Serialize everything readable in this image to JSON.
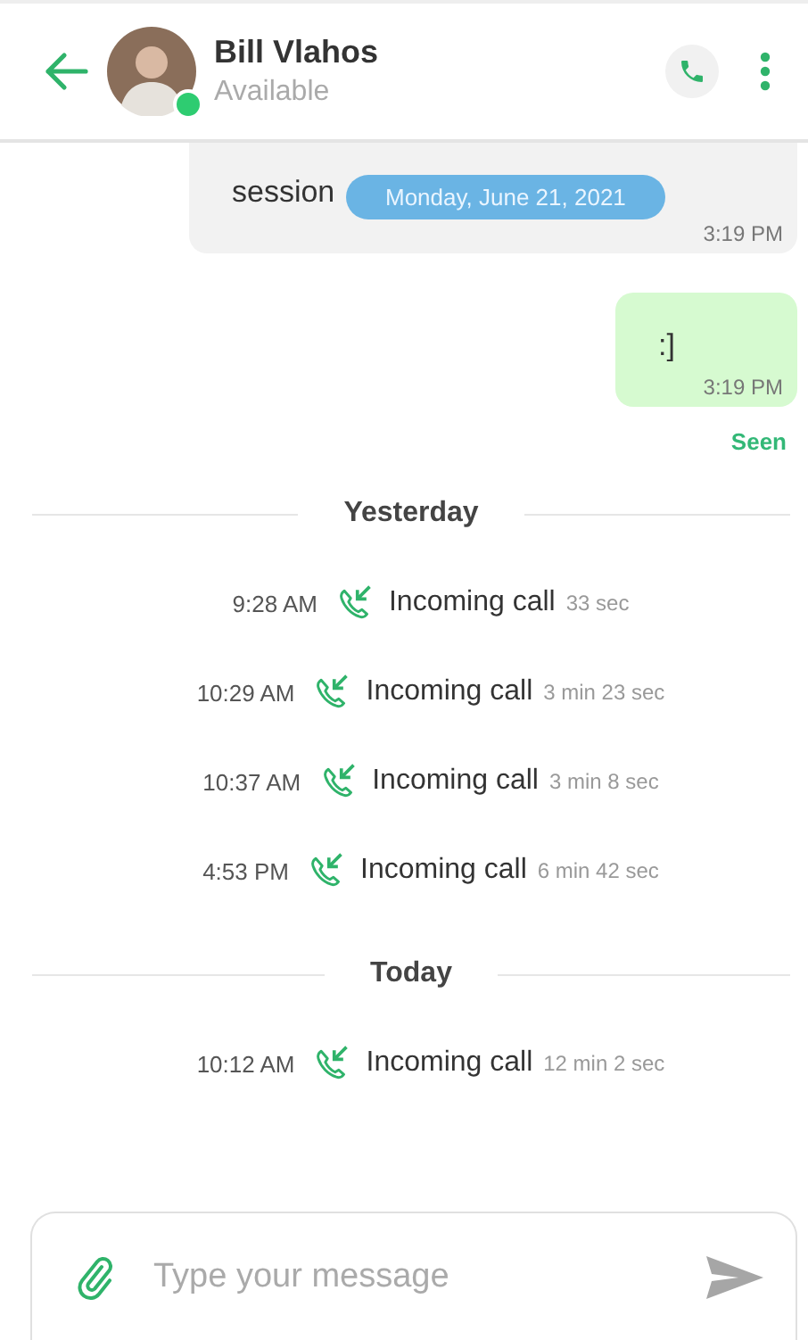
{
  "header": {
    "name": "Bill Vlahos",
    "status": "Available",
    "online": true
  },
  "date_banner": "Monday, June 21, 2021",
  "messages": [
    {
      "kind": "incoming",
      "text": "session",
      "time": "3:19 PM"
    },
    {
      "kind": "outgoing",
      "text": ":]",
      "time": "3:19 PM"
    }
  ],
  "receipt": "Seen",
  "call_groups": [
    {
      "label": "Yesterday",
      "calls": [
        {
          "time": "9:28 AM",
          "label": "Incoming call",
          "duration": "33 sec"
        },
        {
          "time": "10:29 AM",
          "label": "Incoming call",
          "duration": "3 min 23 sec"
        },
        {
          "time": "10:37 AM",
          "label": "Incoming call",
          "duration": "3 min 8 sec"
        },
        {
          "time": "4:53 PM",
          "label": "Incoming call",
          "duration": "6 min 42 sec"
        }
      ]
    },
    {
      "label": "Today",
      "calls": [
        {
          "time": "10:12 AM",
          "label": "Incoming call",
          "duration": "12 min 2 sec"
        }
      ]
    }
  ],
  "composer": {
    "placeholder": "Type your message"
  }
}
